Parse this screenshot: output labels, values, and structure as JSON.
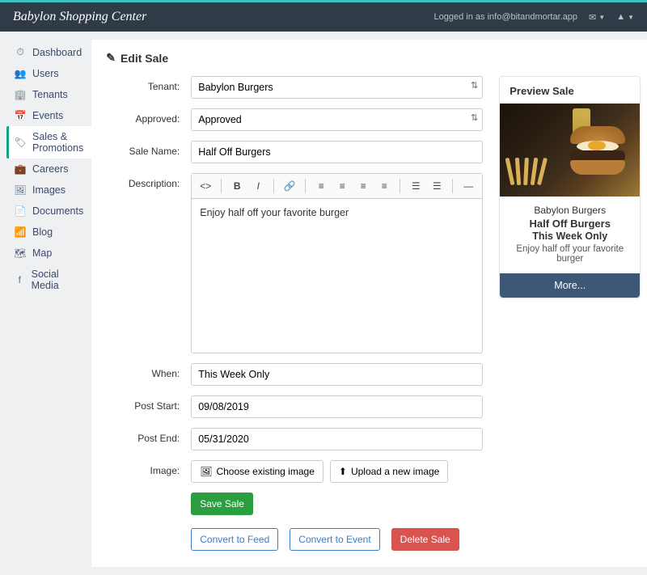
{
  "site_title": "Babylon Shopping Center",
  "login_text": "Logged in as info@bitandmortar.app",
  "sidebar": {
    "items": [
      {
        "label": "Dashboard"
      },
      {
        "label": "Users"
      },
      {
        "label": "Tenants"
      },
      {
        "label": "Events"
      },
      {
        "label": "Sales & Promotions"
      },
      {
        "label": "Careers"
      },
      {
        "label": "Images"
      },
      {
        "label": "Documents"
      },
      {
        "label": "Blog"
      },
      {
        "label": "Map"
      },
      {
        "label": "Social Media"
      }
    ]
  },
  "page": {
    "title": "Edit Sale"
  },
  "form": {
    "labels": {
      "tenant": "Tenant:",
      "approved": "Approved:",
      "sale_name": "Sale Name:",
      "description": "Description:",
      "when": "When:",
      "post_start": "Post Start:",
      "post_end": "Post End:",
      "image": "Image:"
    },
    "values": {
      "tenant": "Babylon Burgers",
      "approved": "Approved",
      "sale_name": "Half Off Burgers",
      "description": "Enjoy half off your favorite burger",
      "when": "This Week Only",
      "post_start": "09/08/2019",
      "post_end": "05/31/2020"
    },
    "buttons": {
      "choose_image": "Choose existing image",
      "upload_image": "Upload a new image",
      "save": "Save Sale",
      "to_feed": "Convert to Feed",
      "to_event": "Convert to Event",
      "delete": "Delete Sale"
    }
  },
  "preview": {
    "heading": "Preview Sale",
    "tenant": "Babylon Burgers",
    "name": "Half Off Burgers",
    "when": "This Week Only",
    "desc": "Enjoy half off your favorite burger",
    "more": "More..."
  }
}
